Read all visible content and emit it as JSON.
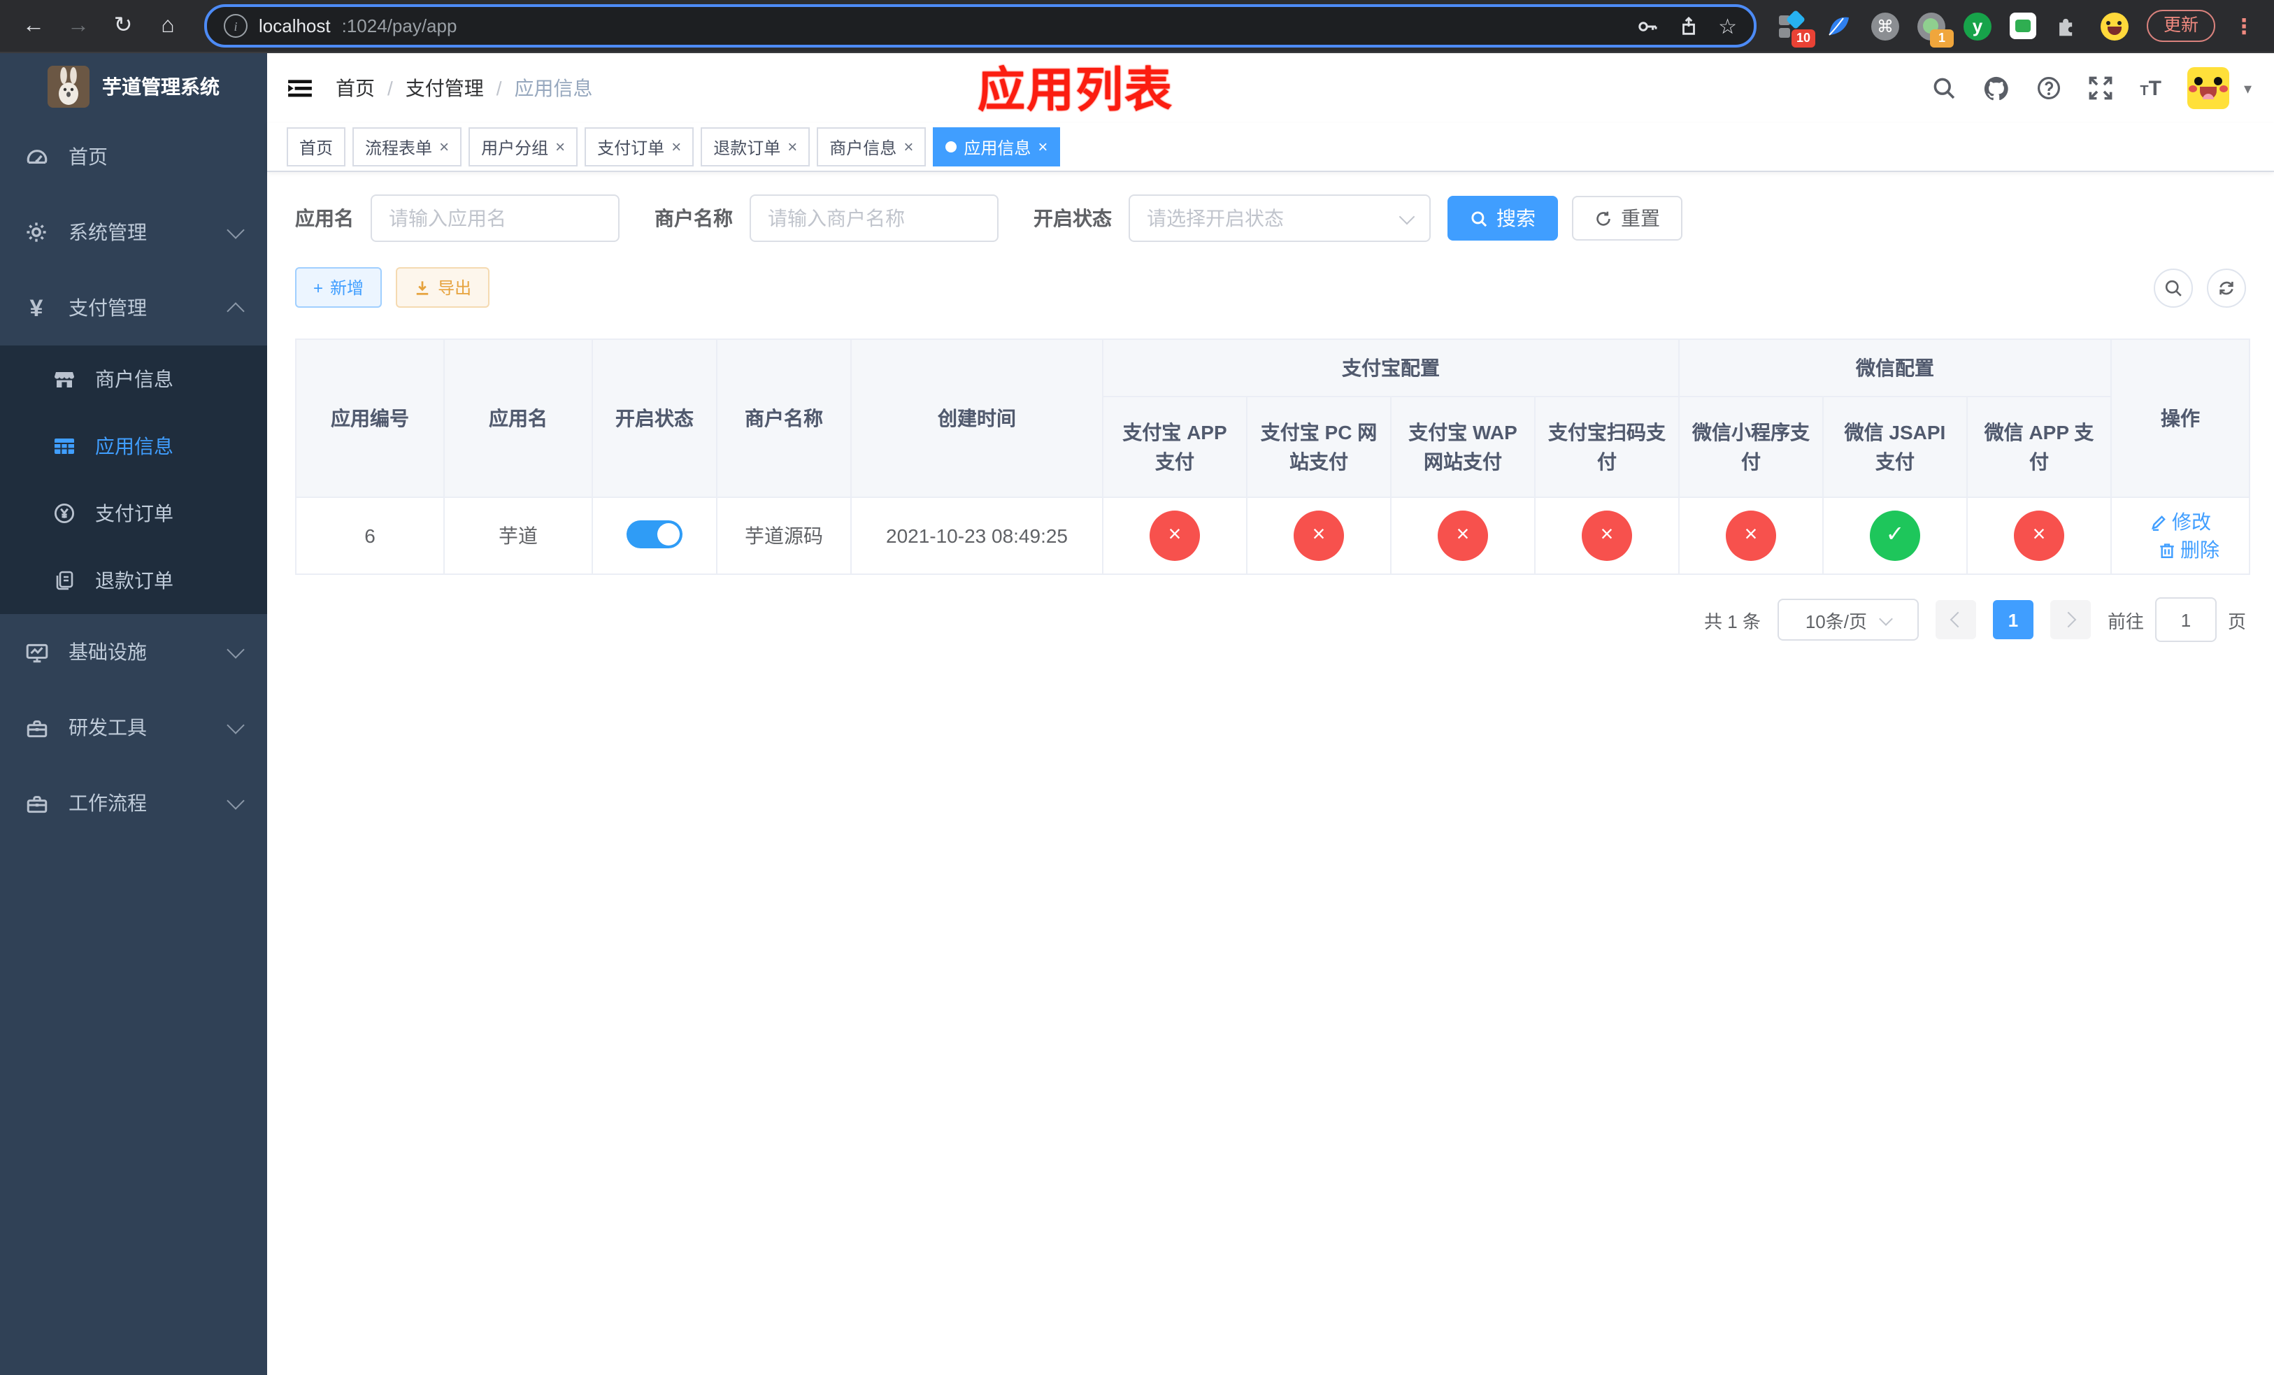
{
  "colors": {
    "primary": "#409eff",
    "success": "#1ec65b",
    "danger": "#f7514d",
    "warning": "#e6a23c",
    "sidebar_bg": "#304156",
    "submenu_bg": "#1f2d3d",
    "active_tab_bg": "#409eff",
    "annotation_red": "#fb1d10"
  },
  "icons": {
    "back": "←",
    "forward": "→",
    "reload": "↻",
    "home": "⌂",
    "info": "i",
    "star": "☆",
    "cmd": "⌘",
    "letter_y": "y",
    "dots": "⋮",
    "caret": "▾",
    "question": "?",
    "close": "×",
    "check": "✓",
    "cross": "×",
    "yen": "¥",
    "plus": "+",
    "font_small": "T",
    "font_large": "T"
  },
  "browser": {
    "url_host": "localhost",
    "url_path": ":1024/pay/app",
    "update_label": "更新",
    "ext_badge_10": "10",
    "ext_badge_1": "1"
  },
  "sidebar": {
    "title": "芋道管理系统",
    "items": [
      {
        "label": "首页"
      },
      {
        "label": "系统管理"
      },
      {
        "label": "支付管理"
      },
      {
        "label": "商户信息"
      },
      {
        "label": "应用信息"
      },
      {
        "label": "支付订单"
      },
      {
        "label": "退款订单"
      },
      {
        "label": "基础设施"
      },
      {
        "label": "研发工具"
      },
      {
        "label": "工作流程"
      }
    ]
  },
  "header": {
    "breadcrumb": [
      "首页",
      "支付管理",
      "应用信息"
    ],
    "breadcrumb_sep": "/",
    "annotation": "应用列表"
  },
  "tabs": {
    "close_glyph": "×",
    "items": [
      {
        "label": "首页"
      },
      {
        "label": "流程表单"
      },
      {
        "label": "用户分组"
      },
      {
        "label": "支付订单"
      },
      {
        "label": "退款订单"
      },
      {
        "label": "商户信息"
      },
      {
        "label": "应用信息"
      }
    ]
  },
  "filters": {
    "app_name_label": "应用名",
    "app_name_placeholder": "请输入应用名",
    "merchant_label": "商户名称",
    "merchant_placeholder": "请输入商户名称",
    "status_label": "开启状态",
    "status_placeholder": "请选择开启状态",
    "search_label": "搜索",
    "reset_label": "重置"
  },
  "toolbar": {
    "add_label": "新增",
    "export_label": "导出"
  },
  "table": {
    "col_app_id": "应用编号",
    "col_app_name": "应用名",
    "col_status": "开启状态",
    "col_merchant": "商户名称",
    "col_created": "创建时间",
    "group_alipay": "支付宝配置",
    "group_wechat": "微信配置",
    "col_op": "操作",
    "sub_cols": [
      "支付宝 APP 支付",
      "支付宝 PC 网站支付",
      "支付宝 WAP 网站支付",
      "支付宝扫码支付",
      "微信小程序支付",
      "微信 JSAPI 支付",
      "微信 APP 支付"
    ],
    "row": {
      "app_id": "6",
      "app_name": "芋道",
      "merchant": "芋道源码",
      "created": "2021-10-23 08:49:25",
      "channels": [
        "×",
        "×",
        "×",
        "×",
        "×",
        "✓",
        "×"
      ],
      "edit_label": "修改",
      "delete_label": "删除"
    }
  },
  "pagination": {
    "total": "共 1 条",
    "page_size": "10条/页",
    "page": "1",
    "goto_label": "前往",
    "goto_value": "1",
    "page_unit": "页"
  }
}
